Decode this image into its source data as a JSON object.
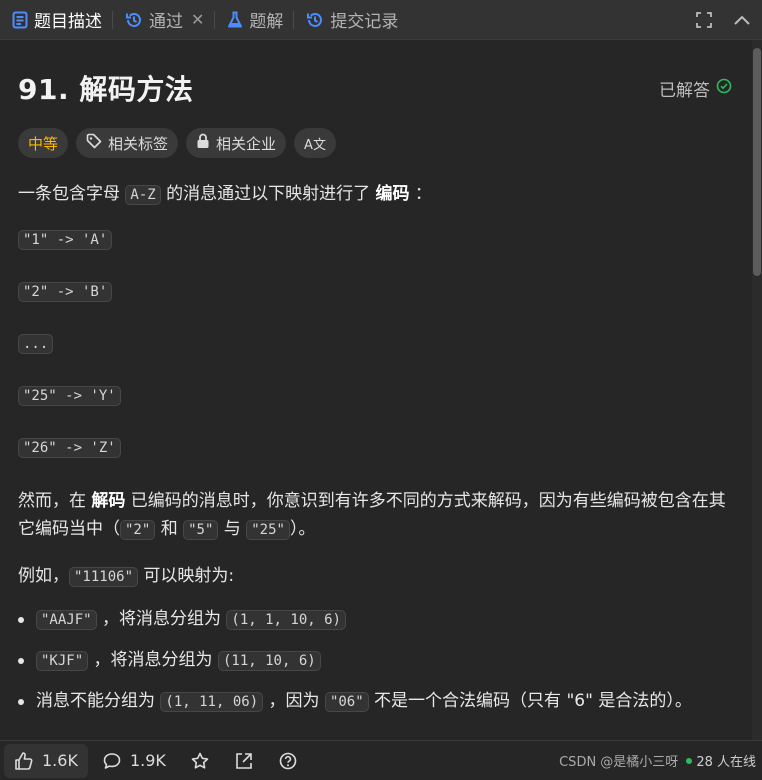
{
  "tabs": [
    {
      "label": "题目描述",
      "icon": "description-icon",
      "active": true
    },
    {
      "label": "通过",
      "icon": "history-icon",
      "closable": true
    },
    {
      "label": "题解",
      "icon": "flask-icon"
    },
    {
      "label": "提交记录",
      "icon": "history-icon"
    }
  ],
  "problem": {
    "title": "91. 解码方法",
    "status": "已解答",
    "tags": {
      "difficulty": "中等",
      "related_tags": "相关标签",
      "related_companies": "相关企业",
      "translate": "A文"
    }
  },
  "description": {
    "intro_before": "一条包含字母 ",
    "intro_code": "A-Z",
    "intro_mid": " 的消息通过以下映射进行了 ",
    "intro_bold": "编码",
    "intro_after": " ：",
    "mappings": [
      "\"1\" -> 'A'",
      "\"2\" -> 'B'",
      "...",
      "\"25\" -> 'Y'",
      "\"26\" -> 'Z'"
    ],
    "p2_a": "然而，在 ",
    "p2_bold": "解码",
    "p2_b": " 已编码的消息时，你意识到有许多不同的方式来解码，因为有些编码被包含在其它编码当中（",
    "p2_code1": "\"2\"",
    "p2_and": " 和 ",
    "p2_code2": "\"5\"",
    "p2_with": " 与 ",
    "p2_code3": "\"25\"",
    "p2_end": "）。",
    "example_a": "例如，",
    "example_code": "\"11106\"",
    "example_b": " 可以映射为:",
    "bullets": [
      {
        "code": "\"AAJF\"",
        "text": " ，将消息分组为 ",
        "code2": "(1, 1, 10, 6)"
      },
      {
        "code": "\"KJF\"",
        "text": " ，将消息分组为 ",
        "code2": "(11, 10, 6)"
      },
      {
        "pre": "消息不能分组为 ",
        "code": "(1, 11, 06)",
        "text": " ，因为 ",
        "code2": "\"06\"",
        "tail": " 不是一个合法编码（只有 \"6\" 是合法的）。"
      }
    ]
  },
  "bottom": {
    "likes": "1.6K",
    "comments": "1.9K",
    "online": "28 人在线",
    "watermark": "CSDN @是橘小三呀"
  },
  "colors": {
    "accent_diff": "#ffb800",
    "solved_check": "#2cbb5d",
    "bg": "#262626"
  }
}
